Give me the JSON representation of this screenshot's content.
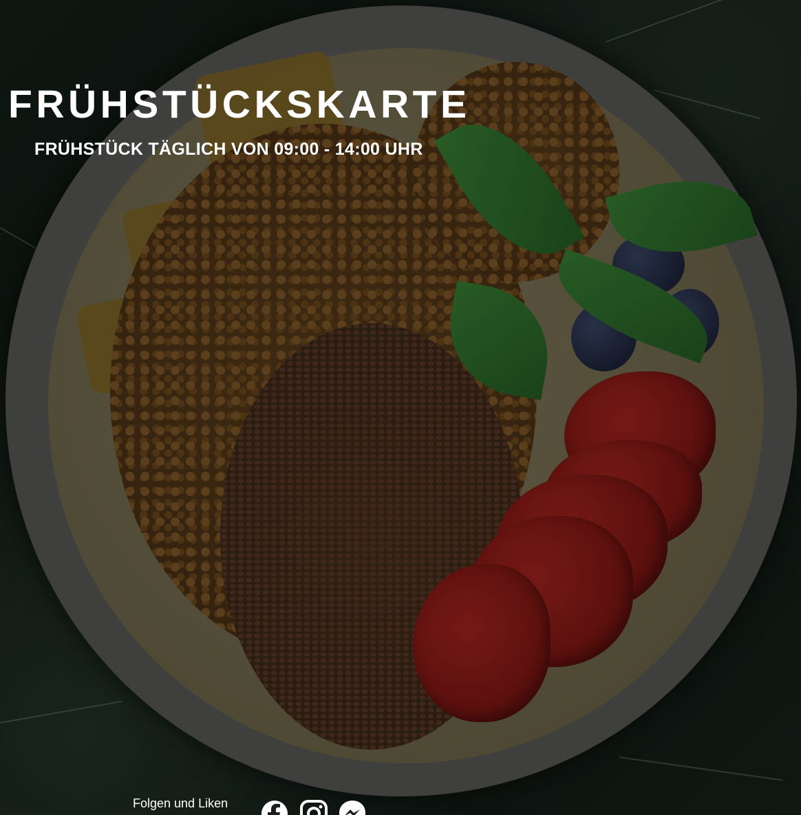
{
  "header": {
    "title": "FRÜHSTÜCKSKARTE",
    "subtitle": "FRÜHSTÜCK TÄGLICH VON 09:00 - 14:00 UHR"
  },
  "footer": {
    "follow_label": "Folgen und Liken",
    "social_links": [
      {
        "icon": "facebook-icon"
      },
      {
        "icon": "instagram-icon"
      },
      {
        "icon": "messenger-icon"
      }
    ]
  },
  "colors": {
    "text": "#ffffff"
  }
}
